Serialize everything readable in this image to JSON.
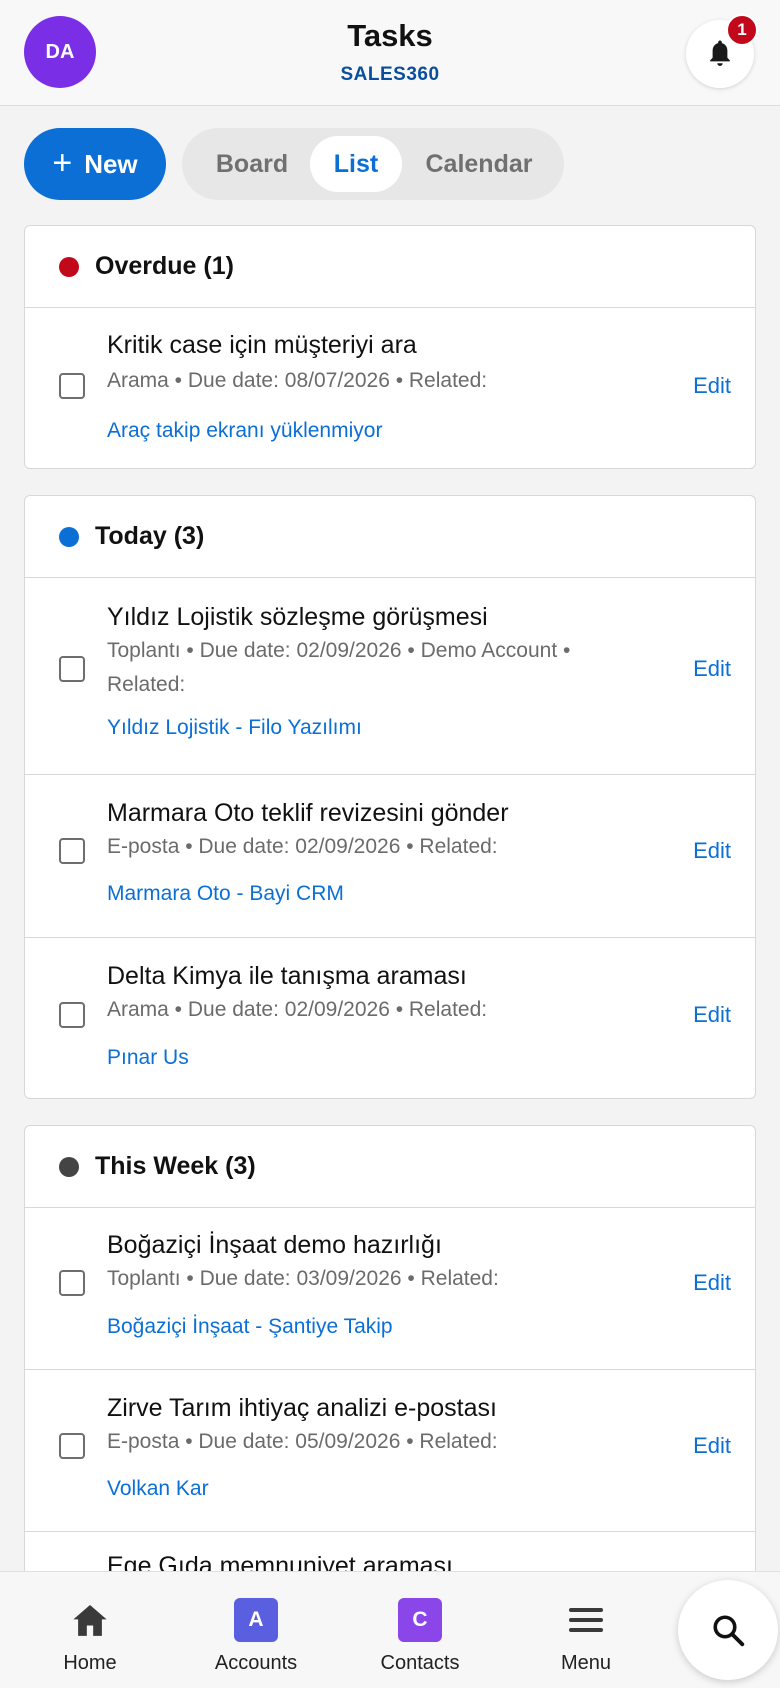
{
  "header": {
    "avatar_initials": "DA",
    "title": "Tasks",
    "subtitle": "SALES360",
    "notification_count": "1"
  },
  "toolbar": {
    "new_label": "New",
    "views": [
      "Board",
      "List",
      "Calendar"
    ],
    "active_view": "List"
  },
  "groups": [
    {
      "title": "Overdue (1)",
      "dot_color": "#c2091c",
      "tasks": [
        {
          "title": "Kritik case için müşteriyi ara",
          "meta": "Arama • Due date: 08/07/2026 • Related:",
          "related": "Araç takip ekranı yüklenmiyor",
          "edit": "Edit"
        }
      ]
    },
    {
      "title": "Today (3)",
      "dot_color": "#0b6fd6",
      "tasks": [
        {
          "title": "Yıldız Lojistik sözleşme görüşmesi",
          "meta": "Toplantı • Due date: 02/09/2026 • Demo Account • Related:",
          "related": "Yıldız Lojistik - Filo Yazılımı",
          "edit": "Edit"
        },
        {
          "title": "Marmara Oto teklif revizesini gönder",
          "meta": "E-posta • Due date: 02/09/2026 • Related:",
          "related": "Marmara Oto - Bayi CRM",
          "edit": "Edit"
        },
        {
          "title": "Delta Kimya ile tanışma araması",
          "meta": "Arama • Due date: 02/09/2026 • Related:",
          "related": "Pınar Us",
          "edit": "Edit"
        }
      ]
    },
    {
      "title": "This Week (3)",
      "dot_color": "#444444",
      "tasks": [
        {
          "title": "Boğaziçi İnşaat demo hazırlığı",
          "meta": "Toplantı • Due date: 03/09/2026 • Related:",
          "related": "Boğaziçi İnşaat - Şantiye Takip",
          "edit": "Edit"
        },
        {
          "title": "Zirve Tarım ihtiyaç analizi e-postası",
          "meta": "E-posta • Due date: 05/09/2026 • Related:",
          "related": "Volkan Kar",
          "edit": "Edit"
        },
        {
          "title": "Ege Gıda memnuniyet araması"
        }
      ]
    }
  ],
  "bottom_nav": {
    "items": [
      {
        "label": "Home",
        "icon": "home-icon"
      },
      {
        "label": "Accounts",
        "icon": "accounts-tile",
        "tile_letter": "A",
        "tile_color": "#5a5fe0"
      },
      {
        "label": "Contacts",
        "icon": "contacts-tile",
        "tile_letter": "C",
        "tile_color": "#8b46ea"
      },
      {
        "label": "Menu",
        "icon": "hamburger-icon"
      }
    ],
    "search_icon": "search-icon"
  }
}
